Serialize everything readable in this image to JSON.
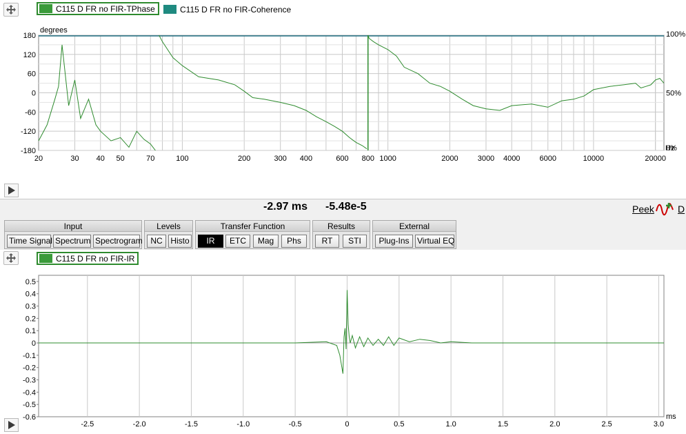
{
  "top_panel": {
    "legend": [
      {
        "label": "C115 D FR no FIR-TPhase",
        "color": "#3a9a3a",
        "selected": true
      },
      {
        "label": "C115 D FR no FIR-Coherence",
        "color": "#1f8a80",
        "selected": false
      }
    ],
    "y_unit": "degrees",
    "y_ticks": [
      "180",
      "120",
      "60",
      "0",
      "-60",
      "-120",
      "-180"
    ],
    "x_ticks": [
      "20",
      "30",
      "40",
      "50",
      "70",
      "100",
      "200",
      "300",
      "400",
      "600",
      "800",
      "1000",
      "2000",
      "3000",
      "4000",
      "6000",
      "10000",
      "20000"
    ],
    "x_unit": "Hz",
    "right_ticks": [
      "100%",
      "50%",
      "0%"
    ]
  },
  "status": {
    "time_readout": "-2.97 ms",
    "value_readout": "-5.48e-5",
    "peek_label": "Peek",
    "d_label": "D"
  },
  "toolbar": {
    "groups": [
      {
        "title": "Input",
        "buttons": [
          "Time Signal",
          "Spectrum",
          "Spectrogram"
        ]
      },
      {
        "title": "Levels",
        "buttons": [
          "NC",
          "Histo"
        ]
      },
      {
        "title": "Transfer Function",
        "buttons": [
          "IR",
          "ETC",
          "Mag",
          "Phs"
        ]
      },
      {
        "title": "Results",
        "buttons": [
          "RT",
          "STI"
        ]
      },
      {
        "title": "External",
        "buttons": [
          "Plug-Ins",
          "Virtual EQ"
        ]
      }
    ],
    "active_button": "IR"
  },
  "bottom_panel": {
    "legend": [
      {
        "label": "C115 D FR no FIR-IR",
        "color": "#3a9a3a",
        "selected": true
      }
    ],
    "y_ticks": [
      "0.5",
      "0.4",
      "0.3",
      "0.2",
      "0.1",
      "0",
      "-0.1",
      "-0.2",
      "-0.3",
      "-0.4",
      "-0.5",
      "-0.6"
    ],
    "x_ticks": [
      "-2.5",
      "-2.0",
      "-1.5",
      "-1.0",
      "-0.5",
      "0",
      "0.5",
      "1.0",
      "1.5",
      "2.0",
      "2.5",
      "3.0"
    ],
    "x_unit": "ms"
  },
  "colors": {
    "trace": "#2e8b2e",
    "grid": "#c8c8c8",
    "border_selected": "#2e8b2e"
  },
  "chart_data": [
    {
      "type": "line",
      "x_scale": "log",
      "xlim": [
        20,
        22000
      ],
      "ylim": [
        -180,
        180
      ],
      "ylabel": "degrees",
      "xlabel": "Hz",
      "series": [
        {
          "name": "C115 D FR no FIR-TPhase",
          "x": [
            20,
            22,
            24,
            25,
            26,
            28,
            30,
            32,
            35,
            38,
            40,
            45,
            50,
            55,
            60,
            65,
            70,
            72,
            74,
            77,
            80,
            90,
            100,
            120,
            150,
            180,
            200,
            220,
            250,
            300,
            350,
            400,
            450,
            500,
            550,
            600,
            650,
            700,
            750,
            790,
            800,
            810,
            850,
            900,
            1000,
            1100,
            1200,
            1400,
            1600,
            1800,
            2000,
            2300,
            2600,
            3000,
            3500,
            4000,
            5000,
            6000,
            7000,
            8000,
            9000,
            10000,
            12000,
            14000,
            16000,
            17000,
            18000,
            19000,
            20000,
            21000,
            22000
          ],
          "y": [
            -150,
            -100,
            -20,
            20,
            150,
            -40,
            40,
            -80,
            -20,
            -100,
            -120,
            -150,
            -140,
            -170,
            -120,
            -145,
            -160,
            -170,
            -180,
            180,
            160,
            110,
            85,
            50,
            40,
            25,
            5,
            -15,
            -20,
            -30,
            -40,
            -55,
            -75,
            -90,
            -105,
            -120,
            -140,
            -155,
            -165,
            -175,
            180,
            170,
            160,
            150,
            135,
            115,
            80,
            60,
            30,
            20,
            5,
            -20,
            -40,
            -50,
            -55,
            -40,
            -35,
            -45,
            -25,
            -20,
            -10,
            10,
            20,
            25,
            30,
            15,
            20,
            25,
            40,
            45,
            30
          ]
        }
      ]
    },
    {
      "type": "line",
      "xlim": [
        -2.97,
        3.05
      ],
      "ylim": [
        -0.6,
        0.55
      ],
      "xlabel": "ms",
      "series": [
        {
          "name": "C115 D FR no FIR-IR",
          "x": [
            -2.97,
            -2.5,
            -2.0,
            -1.5,
            -1.0,
            -0.5,
            -0.2,
            -0.1,
            -0.07,
            -0.05,
            -0.04,
            -0.03,
            -0.02,
            -0.01,
            0.0,
            0.01,
            0.02,
            0.03,
            0.05,
            0.08,
            0.12,
            0.16,
            0.2,
            0.25,
            0.3,
            0.35,
            0.4,
            0.45,
            0.5,
            0.6,
            0.7,
            0.8,
            0.9,
            1.0,
            1.2,
            1.5,
            2.0,
            2.5,
            3.0,
            3.05
          ],
          "y": [
            0.0,
            0.0,
            0.0,
            0.0,
            0.0,
            0.0,
            0.01,
            -0.02,
            -0.1,
            -0.2,
            -0.25,
            0.05,
            0.12,
            -0.05,
            0.43,
            0.15,
            0.05,
            0.0,
            0.06,
            -0.04,
            0.05,
            -0.03,
            0.04,
            -0.02,
            0.03,
            -0.02,
            0.05,
            -0.02,
            0.04,
            0.01,
            0.03,
            0.02,
            0.0,
            0.01,
            0.0,
            0.0,
            0.0,
            0.0,
            0.0,
            0.0
          ]
        }
      ]
    }
  ]
}
